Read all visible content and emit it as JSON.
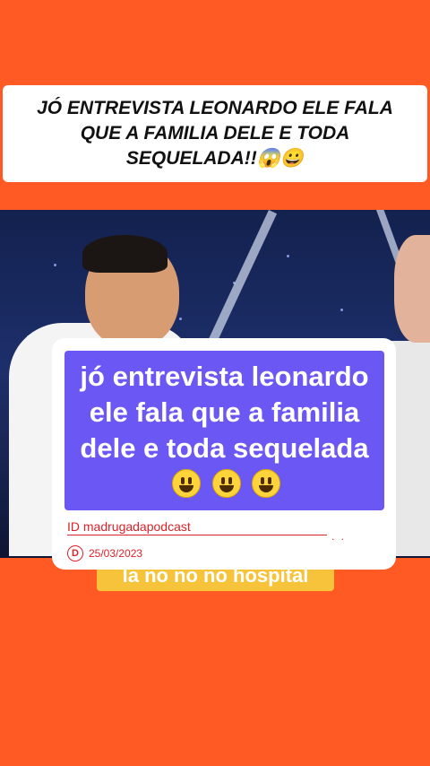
{
  "header": {
    "title": "JÓ ENTREVISTA LEONARDO  ELE FALA QUE A FAMILIA DELE E TODA SEQUELADA!!😱😀"
  },
  "video": {
    "subtitle": "la no no no hospital"
  },
  "caption": {
    "text": "jó entrevista leonardo ele fala que a familia dele e toda sequelada",
    "emoji_count": 3
  },
  "meta": {
    "id_label": "ID  madrugadapodcast",
    "date_icon": "D",
    "date": "25/03/2023",
    "dots": ". ."
  },
  "colors": {
    "background": "#ff5a24",
    "caption_bg": "#6b57f3",
    "meta_red": "#d8232a",
    "subtitle_bg": "#f6c33b"
  }
}
